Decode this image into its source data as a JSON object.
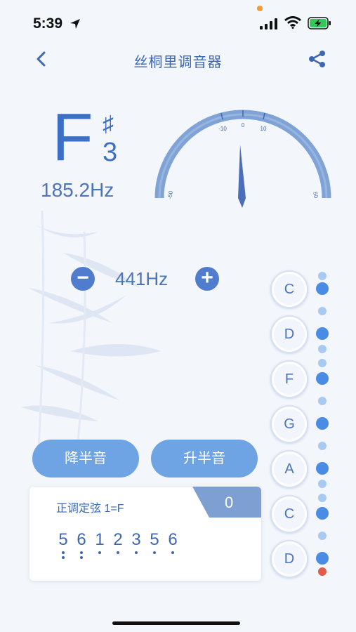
{
  "status_bar": {
    "time": "5:39"
  },
  "nav": {
    "title": "丝桐里调音器"
  },
  "note": {
    "letter": "F",
    "accidental": "♯",
    "octave": "3",
    "frequency": "185.2Hz"
  },
  "meter": {
    "ticks": [
      "-50",
      "-10",
      "0",
      "10",
      "50"
    ]
  },
  "reference": {
    "minus": "−",
    "value": "441Hz",
    "plus": "+"
  },
  "buttons": {
    "semitone_down": "降半音",
    "semitone_up": "升半音"
  },
  "card": {
    "tuning_label": "正调定弦 1=F",
    "count": "0",
    "notes": [
      {
        "n": "5",
        "low": 2
      },
      {
        "n": "6",
        "low": 2
      },
      {
        "n": "1",
        "low": 1
      },
      {
        "n": "2",
        "low": 1
      },
      {
        "n": "3",
        "low": 1
      },
      {
        "n": "5",
        "low": 1
      },
      {
        "n": "6",
        "low": 1
      }
    ]
  },
  "strings": [
    "C",
    "D",
    "F",
    "G",
    "A",
    "C",
    "D"
  ],
  "colors": {
    "accent": "#3d67b5",
    "button": "#6ea3e4",
    "indicator": "#4a8be6",
    "indicator_light": "#a9caf0",
    "alert": "#e15a4a"
  }
}
